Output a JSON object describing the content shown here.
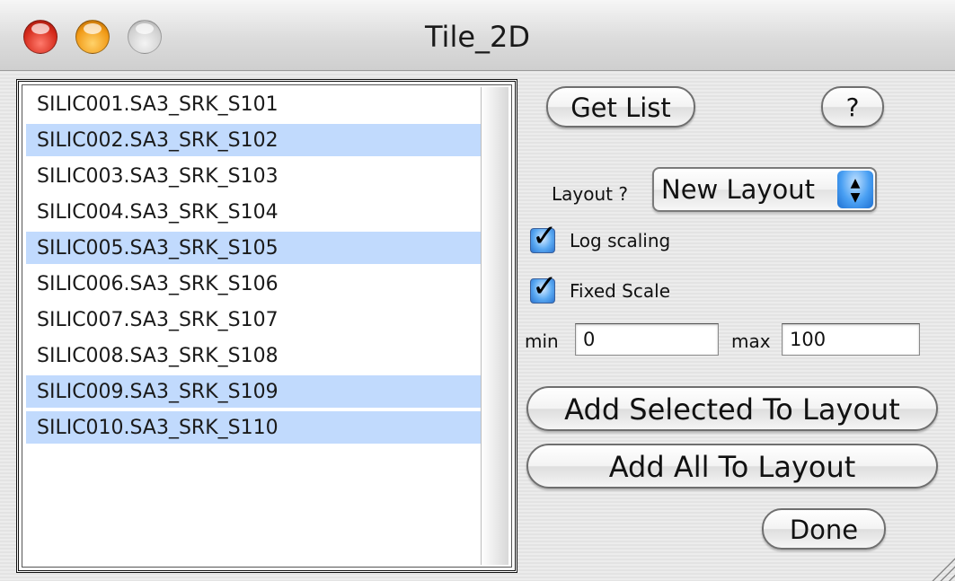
{
  "window": {
    "title": "Tile_2D"
  },
  "list": {
    "items": [
      {
        "label": "SILIC001.SA3_SRK_S101",
        "selected": false
      },
      {
        "label": "SILIC002.SA3_SRK_S102",
        "selected": true
      },
      {
        "label": "SILIC003.SA3_SRK_S103",
        "selected": false
      },
      {
        "label": "SILIC004.SA3_SRK_S104",
        "selected": false
      },
      {
        "label": "SILIC005.SA3_SRK_S105",
        "selected": true
      },
      {
        "label": "SILIC006.SA3_SRK_S106",
        "selected": false
      },
      {
        "label": "SILIC007.SA3_SRK_S107",
        "selected": false
      },
      {
        "label": "SILIC008.SA3_SRK_S108",
        "selected": false
      },
      {
        "label": "SILIC009.SA3_SRK_S109",
        "selected": true
      },
      {
        "label": "SILIC010.SA3_SRK_S110",
        "selected": true
      }
    ]
  },
  "controls": {
    "get_list_label": "Get List",
    "help_label": "?",
    "layout_label": "Layout ?",
    "layout_value": "New Layout",
    "log_scaling_label": "Log scaling",
    "log_scaling_checked": true,
    "fixed_scale_label": "Fixed Scale",
    "fixed_scale_checked": true,
    "min_label": "min",
    "min_value": "0",
    "max_label": "max",
    "max_value": "100",
    "add_selected_label": "Add Selected To Layout",
    "add_all_label": "Add All To Layout",
    "done_label": "Done"
  },
  "colors": {
    "selection": "#c1dafd",
    "aqua_accent": "#4aa0f3"
  }
}
